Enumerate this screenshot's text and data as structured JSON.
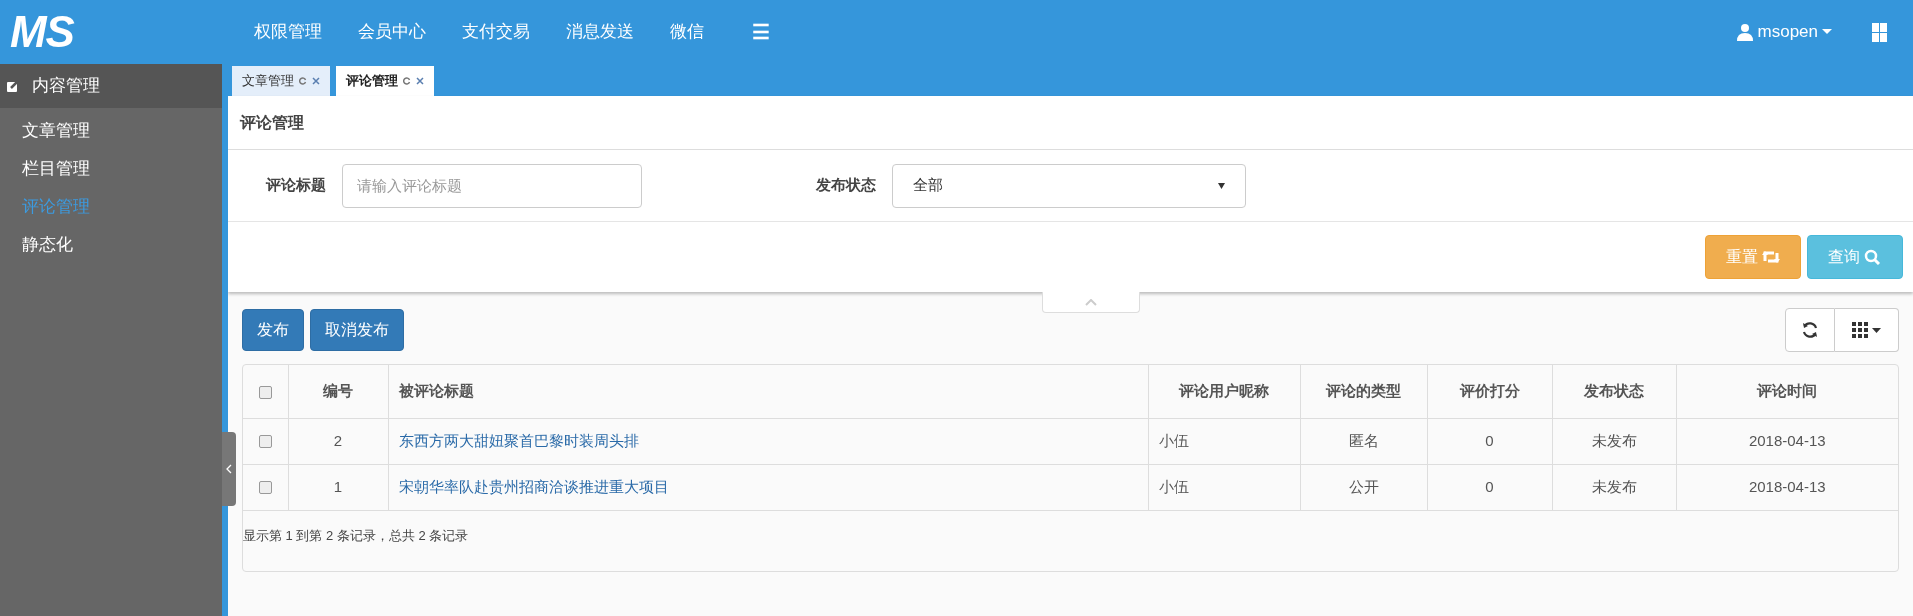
{
  "logo": "MS",
  "top_nav": [
    {
      "label": "权限管理"
    },
    {
      "label": "会员中心"
    },
    {
      "label": "支付交易"
    },
    {
      "label": "消息发送"
    },
    {
      "label": "微信"
    }
  ],
  "menu_toggle": "☰",
  "user": {
    "name": "msopen"
  },
  "sidebar": {
    "group": "内容管理",
    "items": [
      {
        "label": "文章管理",
        "selected": false
      },
      {
        "label": "栏目管理",
        "selected": false
      },
      {
        "label": "评论管理",
        "selected": true
      },
      {
        "label": "静态化",
        "selected": false
      }
    ]
  },
  "tabs": [
    {
      "label": "文章管理",
      "selected": false
    },
    {
      "label": "评论管理",
      "selected": true
    }
  ],
  "page_title": "评论管理",
  "filters": [
    {
      "kind": "text",
      "label": "评论标题",
      "placeholder": "请输入评论标题"
    },
    {
      "kind": "select",
      "label": "发布状态",
      "value": "全部"
    }
  ],
  "search_buttons": [
    {
      "kind": "reset",
      "label": "重置"
    },
    {
      "kind": "query",
      "label": "查询"
    }
  ],
  "actions": [
    "发布",
    "取消发布"
  ],
  "table": {
    "header_checked": false,
    "columns": [
      "编号",
      "被评论标题",
      "评论用户昵称",
      "评论的类型",
      "评价打分",
      "发布状态",
      "评论时间"
    ],
    "rows": [
      {
        "checked": false,
        "cells": [
          "2",
          "东西方两大甜妞聚首巴黎时装周头排",
          "小伍",
          "匿名",
          "0",
          "未发布",
          "2018-04-13"
        ]
      },
      {
        "checked": false,
        "cells": [
          "1",
          "宋朝华率队赴贵州招商洽谈推进重大项目",
          "小伍",
          "公开",
          "0",
          "未发布",
          "2018-04-13"
        ]
      }
    ]
  },
  "pagination_info": "显示第 1 到第 2 条记录，总共 2 条记录"
}
